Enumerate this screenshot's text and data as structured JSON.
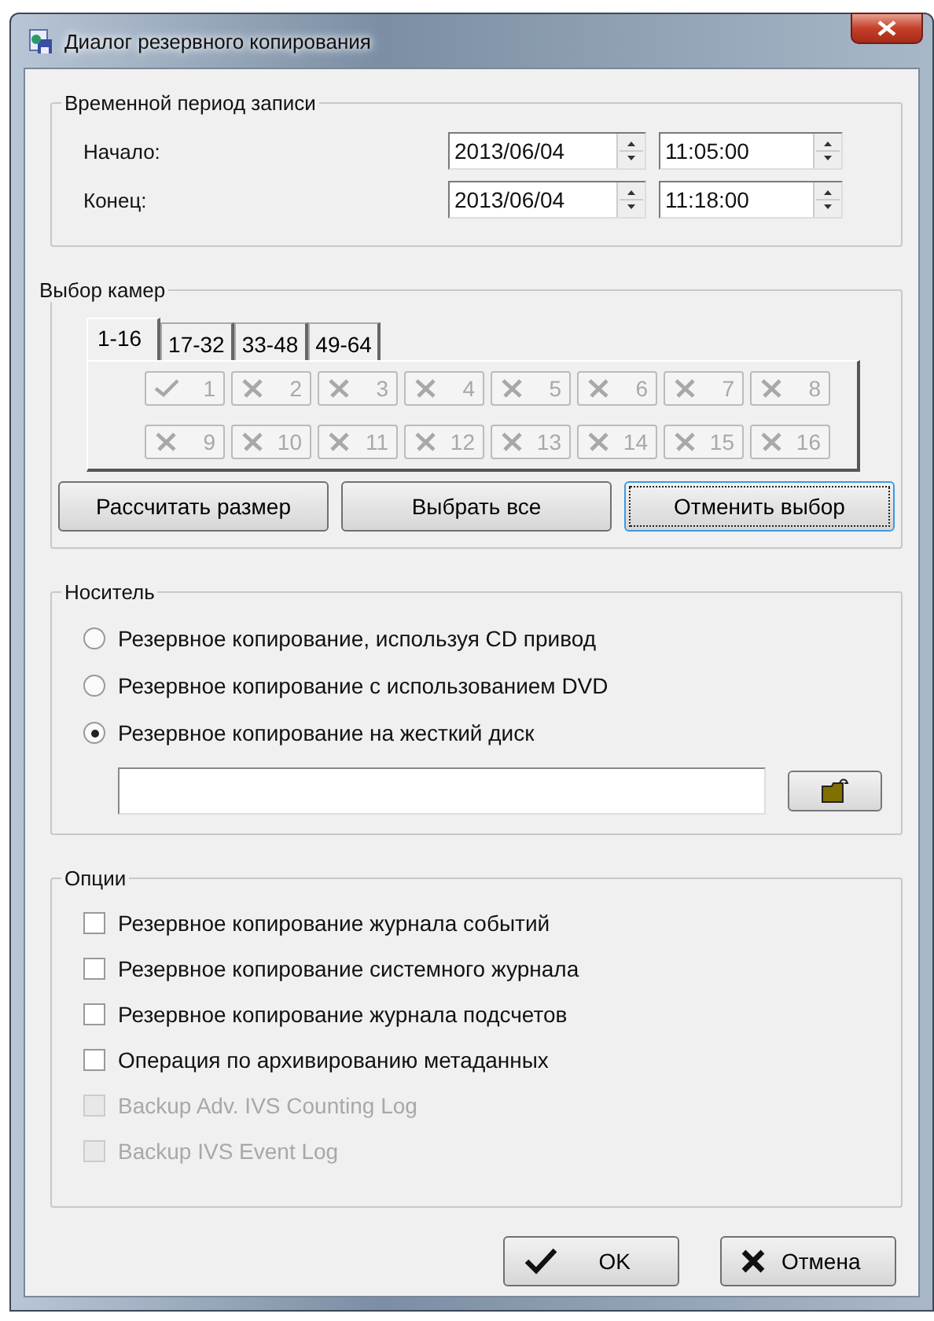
{
  "window": {
    "title": "Диалог резервного копирования"
  },
  "time_period": {
    "title": "Временной период записи",
    "rows": [
      {
        "label": "Начало:",
        "date": "2013/06/04",
        "time": "11:05:00"
      },
      {
        "label": "Конец:",
        "date": "2013/06/04",
        "time": "11:18:00"
      }
    ]
  },
  "camera_selection": {
    "title": "Выбор камер",
    "tabs": [
      {
        "label": "1-16",
        "selected": true
      },
      {
        "label": "17-32",
        "selected": false
      },
      {
        "label": "33-48",
        "selected": false
      },
      {
        "label": "49-64",
        "selected": false
      }
    ],
    "cameras": [
      {
        "label": "1",
        "checked": true,
        "disabled": true
      },
      {
        "label": "2",
        "checked": false,
        "disabled": true
      },
      {
        "label": "3",
        "checked": false,
        "disabled": true
      },
      {
        "label": "4",
        "checked": false,
        "disabled": true
      },
      {
        "label": "5",
        "checked": false,
        "disabled": true
      },
      {
        "label": "6",
        "checked": false,
        "disabled": true
      },
      {
        "label": "7",
        "checked": false,
        "disabled": true
      },
      {
        "label": "8",
        "checked": false,
        "disabled": true
      },
      {
        "label": "9",
        "checked": false,
        "disabled": true
      },
      {
        "label": "10",
        "checked": false,
        "disabled": true
      },
      {
        "label": "11",
        "checked": false,
        "disabled": true
      },
      {
        "label": "12",
        "checked": false,
        "disabled": true
      },
      {
        "label": "13",
        "checked": false,
        "disabled": true
      },
      {
        "label": "14",
        "checked": false,
        "disabled": true
      },
      {
        "label": "15",
        "checked": false,
        "disabled": true
      },
      {
        "label": "16",
        "checked": false,
        "disabled": true
      }
    ],
    "buttons": [
      {
        "label": "Рассчитать размер",
        "focused": false
      },
      {
        "label": "Выбрать  все",
        "focused": false
      },
      {
        "label": "Отменить выбор",
        "focused": true
      }
    ]
  },
  "media": {
    "title": "Носитель",
    "options": [
      {
        "label": "Резервное копирование, используя CD привод",
        "selected": false
      },
      {
        "label": "Резервное копирование с использованием DVD",
        "selected": false
      },
      {
        "label": "Резервное копирование на жесткий диск",
        "selected": true
      }
    ]
  },
  "options": {
    "title": "Опции",
    "items": [
      {
        "label": "Резервное копирование журнала событий",
        "checked": false,
        "disabled": false
      },
      {
        "label": "Резервное копирование системного журнала",
        "checked": false,
        "disabled": false
      },
      {
        "label": "Резервное копирование журнала подсчетов",
        "checked": false,
        "disabled": false
      },
      {
        "label": "Операция по архивированию метаданных",
        "checked": false,
        "disabled": false
      },
      {
        "label": "Backup Adv. IVS Counting Log",
        "checked": false,
        "disabled": true
      },
      {
        "label": "Backup IVS Event Log",
        "checked": false,
        "disabled": true
      }
    ]
  },
  "footer_buttons": [
    {
      "label": "OK",
      "kind": "ok"
    },
    {
      "label": "Отмена",
      "kind": "cancel"
    }
  ]
}
